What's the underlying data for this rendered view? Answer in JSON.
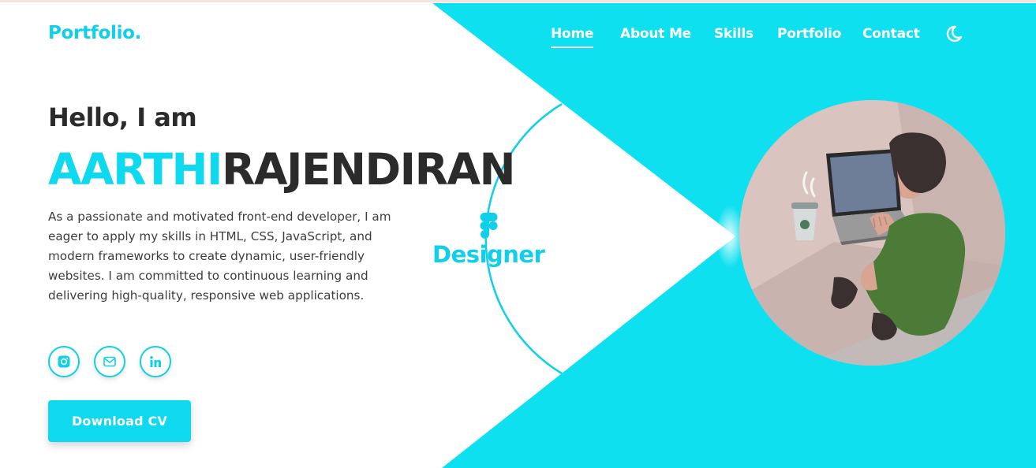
{
  "brand": {
    "logo_text": "Portfolio."
  },
  "nav": {
    "items": [
      {
        "label": "Home",
        "active": true
      },
      {
        "label": "About Me",
        "active": false
      },
      {
        "label": "Skills",
        "active": false
      },
      {
        "label": "Portfolio",
        "active": false
      },
      {
        "label": "Contact",
        "active": false
      }
    ],
    "theme_toggle_icon": "moon-icon"
  },
  "hero": {
    "greeting": "Hello, I am",
    "first_name": "AARTHI",
    "last_name": "RAJENDIRAN",
    "bio": "As a passionate and motivated front-end developer, I am eager to apply my skills in HTML, CSS, JavaScript, and modern frameworks to create dynamic, user-friendly websites. I am committed to continuous learning and delivering high-quality, responsive web applications.",
    "role_label": "Designer",
    "role_icon": "figma-icon",
    "download_label": "Download CV",
    "socials": [
      {
        "icon": "instagram-icon"
      },
      {
        "icon": "mail-icon"
      },
      {
        "icon": "linkedin-icon"
      }
    ],
    "illustration": "person-at-laptop-illustration"
  },
  "colors": {
    "accent": "#0fd9ee",
    "accent_text": "#0fd0e8",
    "heading": "#2b2b2b",
    "body_text": "#3d3d3d",
    "background": "#ffffff"
  }
}
